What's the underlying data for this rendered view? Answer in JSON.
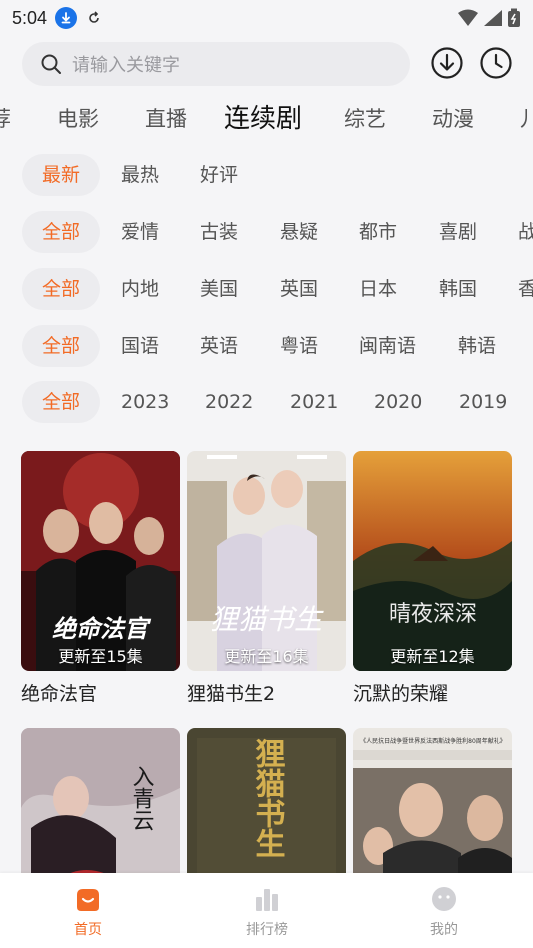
{
  "status": {
    "time": "5:04"
  },
  "search": {
    "placeholder": "请输入关键字"
  },
  "categories": [
    "荐",
    "电影",
    "直播",
    "连续剧",
    "综艺",
    "动漫",
    "儿"
  ],
  "filters": {
    "sort": [
      "最新",
      "最热",
      "好评"
    ],
    "genre": [
      "全部",
      "爱情",
      "古装",
      "悬疑",
      "都市",
      "喜剧",
      "战"
    ],
    "region": [
      "全部",
      "内地",
      "美国",
      "英国",
      "日本",
      "韩国",
      "香"
    ],
    "language": [
      "全部",
      "国语",
      "英语",
      "粤语",
      "闽南语",
      "韩语"
    ],
    "year": [
      "全部",
      "2023",
      "2022",
      "2021",
      "2020",
      "2019"
    ]
  },
  "shows": [
    {
      "title": "绝命法官",
      "episode": "更新至15集",
      "poster_text": "绝命法官"
    },
    {
      "title": "狸猫书生2",
      "episode": "更新至16集",
      "poster_text": "狸猫书生"
    },
    {
      "title": "沉默的荣耀",
      "episode": "更新至12集",
      "poster_text": "晴夜深深"
    },
    {
      "title": "",
      "episode": "",
      "poster_text": "入青云"
    },
    {
      "title": "",
      "episode": "",
      "poster_text": "狸猫书生"
    },
    {
      "title": "",
      "episode": "",
      "poster_text": "《人民抗日战争暨世界反法西斯战争胜利80周年献礼》"
    }
  ],
  "nav": [
    "首页",
    "排行榜",
    "我的"
  ],
  "colors": {
    "accent": "#f26b26",
    "background": "#f5f5f7"
  }
}
